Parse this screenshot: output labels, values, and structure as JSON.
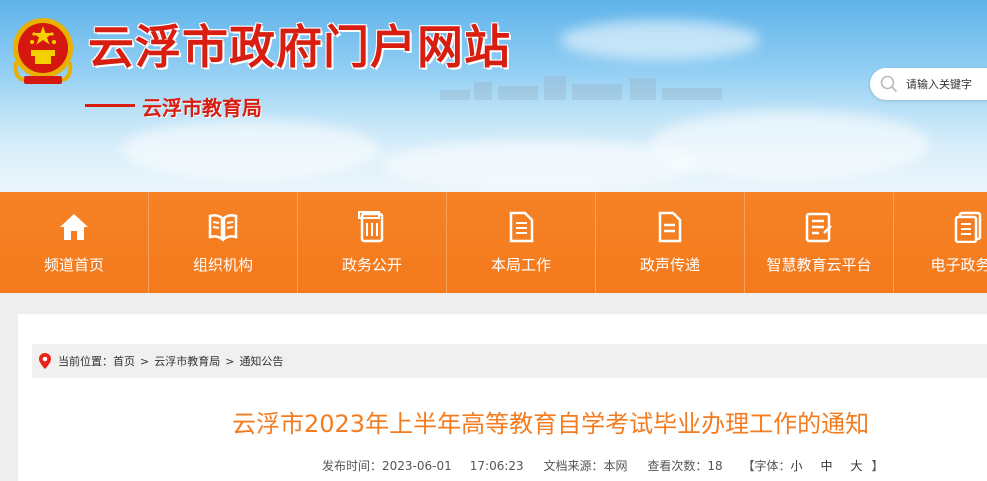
{
  "header": {
    "site_title": "云浮市政府门户网站",
    "sub_title": "云浮市教育局",
    "search": {
      "placeholder": "请输入关键字",
      "icon": "search-icon"
    }
  },
  "nav": {
    "items": [
      {
        "label": "频道首页",
        "icon": "home-icon"
      },
      {
        "label": "组织机构",
        "icon": "book-icon"
      },
      {
        "label": "政务公开",
        "icon": "document-icon"
      },
      {
        "label": "本局工作",
        "icon": "file-icon"
      },
      {
        "label": "政声传递",
        "icon": "notes-icon"
      },
      {
        "label": "智慧教育云平台",
        "icon": "clipboard-icon"
      },
      {
        "label": "电子政务云",
        "icon": "docs-icon"
      }
    ],
    "color": "#f47c20"
  },
  "breadcrumb": {
    "prefix": "当前位置：",
    "items": [
      "首页",
      "云浮市教育局",
      "通知公告"
    ],
    "separator": ">"
  },
  "article": {
    "title": "云浮市2023年上半年高等教育自学考试毕业办理工作的通知",
    "publish_label": "发布时间：",
    "publish_date": "2023-06-01",
    "publish_time": "17:06:23",
    "source_label": "文档来源：",
    "source": "本网",
    "views_label": "查看次数：",
    "views": "18",
    "font_label_open": "【字体：",
    "font_small": "小",
    "font_medium": "中",
    "font_large": "大",
    "font_label_close": "】"
  },
  "colors": {
    "title_red": "#d81e10",
    "accent_orange": "#f47c20"
  }
}
